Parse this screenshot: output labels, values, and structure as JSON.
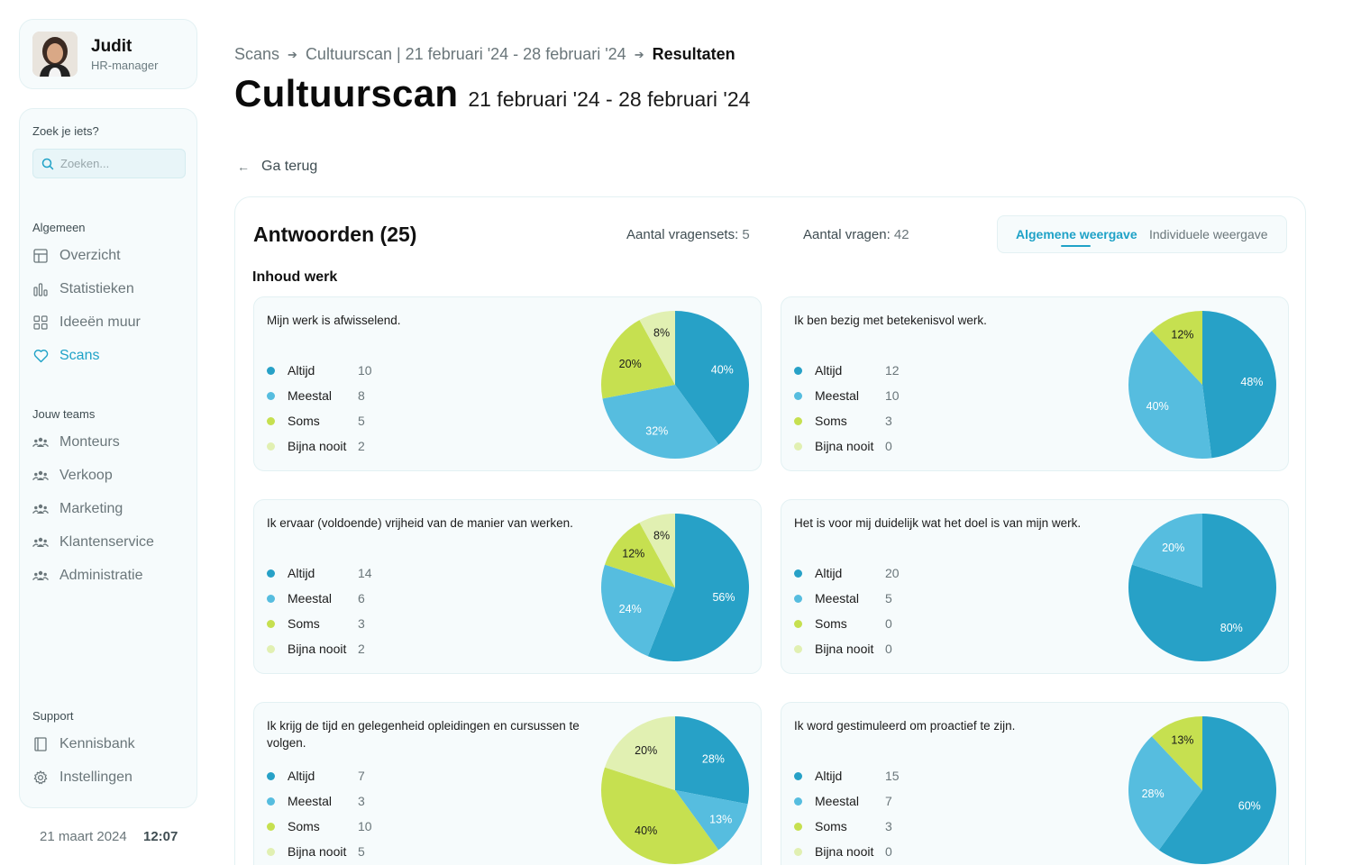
{
  "profile": {
    "name": "Judit",
    "role": "HR-manager"
  },
  "sidebar": {
    "search_label": "Zoek je iets?",
    "search_placeholder": "Zoeken...",
    "general_label": "Algemeen",
    "general_items": [
      {
        "label": "Overzicht",
        "icon": "layout-icon"
      },
      {
        "label": "Statistieken",
        "icon": "bar-chart-icon"
      },
      {
        "label": "Ideeën muur",
        "icon": "grid-icon"
      },
      {
        "label": "Scans",
        "icon": "heart-icon",
        "active": true
      }
    ],
    "teams_label": "Jouw teams",
    "teams": [
      "Monteurs",
      "Verkoop",
      "Marketing",
      "Klantenservice",
      "Administratie"
    ],
    "support_label": "Support",
    "support_items": [
      {
        "label": "Kennisbank",
        "icon": "book-icon"
      },
      {
        "label": "Instellingen",
        "icon": "gear-icon"
      }
    ],
    "date": "21 maart 2024",
    "time": "12:07"
  },
  "breadcrumb": [
    "Scans",
    "Cultuurscan | 21 februari '24 - 28 februari '24",
    "Resultaten"
  ],
  "title": {
    "main": "Cultuurscan",
    "range": "21 februari '24 - 28 februari '24"
  },
  "back_label": "Ga terug",
  "answers": {
    "title": "Antwoorden (25)",
    "sets_label": "Aantal vragensets:",
    "sets_value": "5",
    "questions_label": "Aantal vragen:",
    "questions_value": "42",
    "view_general": "Algemene weergave",
    "view_individual": "Individuele weergave",
    "section": "Inhoud werk"
  },
  "colors": {
    "accent": "#1fa2c7",
    "Altijd": "#27a1c7",
    "Meestal": "#56bddf",
    "Soms": "#c6e050",
    "Bijna nooit": "#e1f0b2"
  },
  "chart_data": [
    {
      "type": "pie",
      "question": "Mijn werk is afwisselend.",
      "categories": [
        "Altijd",
        "Meestal",
        "Soms",
        "Bijna nooit"
      ],
      "values": [
        10,
        8,
        5,
        2
      ],
      "labels": [
        "40%",
        "32%",
        "20%",
        "8%"
      ]
    },
    {
      "type": "pie",
      "question": "Ik ben bezig met betekenisvol werk.",
      "categories": [
        "Altijd",
        "Meestal",
        "Soms",
        "Bijna nooit"
      ],
      "values": [
        12,
        10,
        3,
        0
      ],
      "labels": [
        "48%",
        "40%",
        "12%",
        ""
      ]
    },
    {
      "type": "pie",
      "question": "Ik ervaar (voldoende) vrijheid van de manier van werken.",
      "categories": [
        "Altijd",
        "Meestal",
        "Soms",
        "Bijna nooit"
      ],
      "values": [
        14,
        6,
        3,
        2
      ],
      "labels": [
        "56%",
        "24%",
        "12%",
        "8%"
      ]
    },
    {
      "type": "pie",
      "question": "Het is voor mij duidelijk wat het doel is van mijn werk.",
      "categories": [
        "Altijd",
        "Meestal",
        "Soms",
        "Bijna nooit"
      ],
      "values": [
        20,
        5,
        0,
        0
      ],
      "labels": [
        "80%",
        "20%",
        "",
        ""
      ]
    },
    {
      "type": "pie",
      "question": "Ik krijg de tijd en gelegenheid opleidingen en cursussen te volgen.",
      "categories": [
        "Altijd",
        "Meestal",
        "Soms",
        "Bijna nooit"
      ],
      "values": [
        7,
        3,
        10,
        5
      ],
      "labels": [
        "28%",
        "13%",
        "40%",
        "20%"
      ]
    },
    {
      "type": "pie",
      "question": "Ik word gestimuleerd om proactief te zijn.",
      "categories": [
        "Altijd",
        "Meestal",
        "Soms",
        "Bijna nooit"
      ],
      "values": [
        15,
        7,
        3,
        0
      ],
      "labels": [
        "60%",
        "28%",
        "13%",
        ""
      ]
    }
  ]
}
